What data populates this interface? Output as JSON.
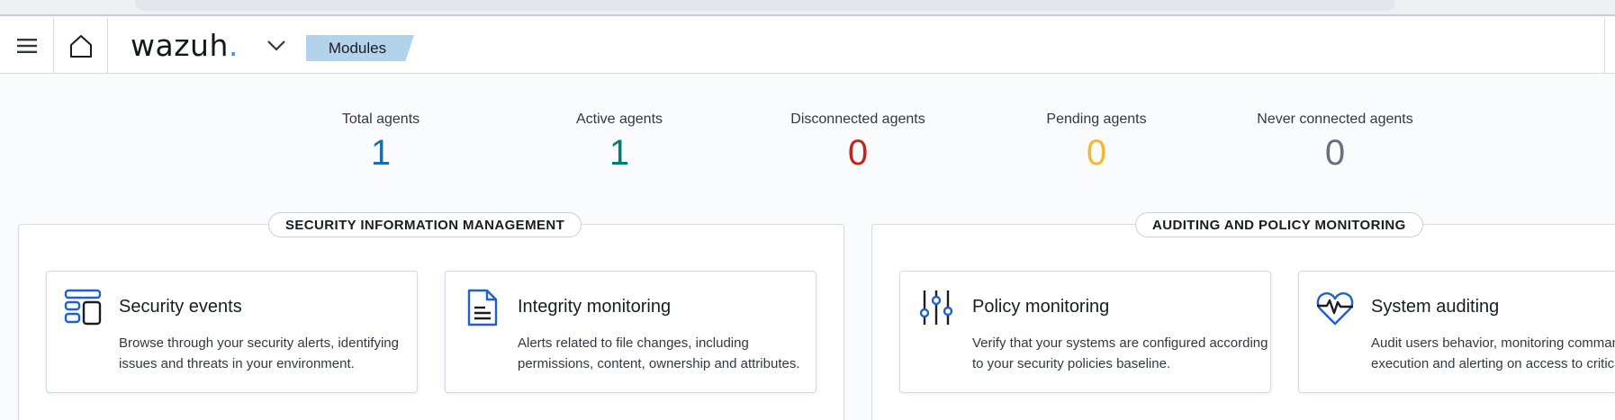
{
  "colors": {
    "total": "#1f6fa6",
    "active": "#017d73",
    "disconnected": "#bd271e",
    "pending": "#f5b82e",
    "never": "#69707d",
    "accent": "#1f5fd1",
    "breadcrumb_bg": "#b2d3ec"
  },
  "header": {
    "logo_text": "wazuh",
    "logo_dot": ".",
    "breadcrumb": "Modules"
  },
  "stats": [
    {
      "label": "Total agents",
      "value": "1"
    },
    {
      "label": "Active agents",
      "value": "1"
    },
    {
      "label": "Disconnected agents",
      "value": "0"
    },
    {
      "label": "Pending agents",
      "value": "0"
    },
    {
      "label": "Never connected agents",
      "value": "0"
    }
  ],
  "sections": [
    {
      "title": "SECURITY INFORMATION MANAGEMENT",
      "cards": [
        {
          "icon": "dashboard-icon",
          "title": "Security events",
          "description": "Browse through your security alerts, identifying issues and threats in your environment."
        },
        {
          "icon": "document-icon",
          "title": "Integrity monitoring",
          "description": "Alerts related to file changes, including permissions, content, ownership and attributes."
        }
      ]
    },
    {
      "title": "AUDITING AND POLICY MONITORING",
      "cards": [
        {
          "icon": "sliders-icon",
          "title": "Policy monitoring",
          "description": "Verify that your systems are configured according to your security policies baseline."
        },
        {
          "icon": "heartbeat-icon",
          "title": "System auditing",
          "description": "Audit users behavior, monitoring command execution and alerting on access to critical files."
        }
      ]
    }
  ]
}
